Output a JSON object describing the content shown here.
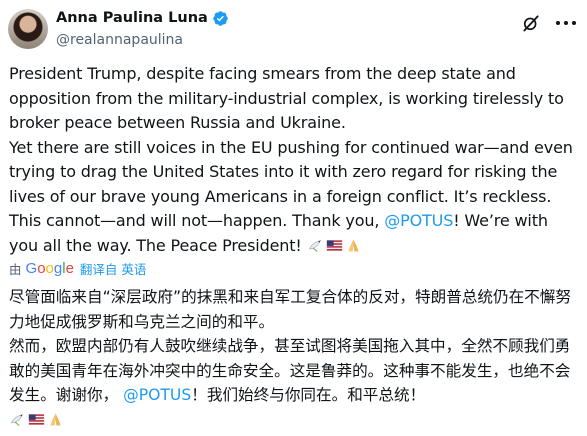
{
  "author": {
    "display_name": "Anna Paulina Luna",
    "handle": "@realannapaulina"
  },
  "icons": {
    "verified": "verified-badge-icon",
    "grok": "grok-icon",
    "more": "more-options-icon",
    "emoji": [
      "dove-emoji",
      "us-flag-emoji",
      "folded-hands-emoji"
    ]
  },
  "post": {
    "paragraph1": "President Trump, despite facing smears from the deep state and opposition from the military-industrial complex, is working tirelessly to broker peace between Russia and Ukraine.",
    "paragraph2_before_mention": "Yet there are still voices in the EU pushing for continued war—and even trying to drag the United States into it with zero regard for risking the lives of our brave young Americans in a foreign conflict. It’s reckless. This cannot—and will not—happen. Thank you, ",
    "mention": "@POTUS",
    "paragraph2_after_mention": "! We’re with you all the way. The Peace President!"
  },
  "translation": {
    "by_label": "由",
    "provider": "Google",
    "link": "翻译自 英语",
    "paragraph1": "尽管面临来自“深层政府”的抹黑和来自军工复合体的反对，特朗普总统仍在不懈努力地促成俄罗斯和乌克兰之间的和平。",
    "paragraph2_before_mention": "然而，欧盟内部仍有人鼓吹继续战争，甚至试图将美国拖入其中，全然不顾我们勇敢的美国青年在海外冲突中的生命安全。这是鲁莽的。这种事不能发生，也绝不会发生。谢谢你，",
    "mention": "@POTUS",
    "paragraph2_after_mention": "！我们始终与你同在。和平总统！"
  },
  "colors": {
    "link": "#1d9bf0",
    "verified": "#1d9bf0",
    "secondary_text": "#536471"
  }
}
